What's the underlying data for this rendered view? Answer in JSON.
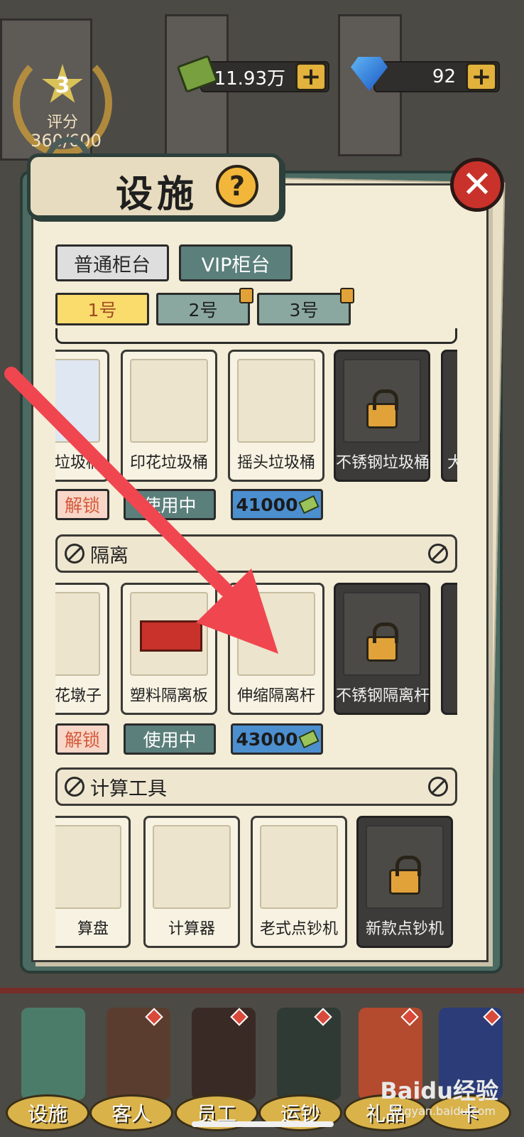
{
  "currency": {
    "cash": "11.93万",
    "gems": "92"
  },
  "rating": {
    "level": "3",
    "label": "评分",
    "score": "360/600"
  },
  "dialog": {
    "title": "设施",
    "help": "?",
    "close": "✕"
  },
  "tabs": {
    "normal": "普通柜台",
    "vip": "VIP柜台"
  },
  "counters": [
    "1号",
    "2号",
    "3号"
  ],
  "trash_row": {
    "items": [
      "垃圾桶",
      "印花垃圾桶",
      "摇头垃圾桶",
      "不锈钢垃圾桶",
      "大"
    ],
    "status": [
      "解锁",
      "使用中",
      "41000"
    ]
  },
  "isolation": {
    "section": "隔离",
    "items": [
      "花墩子",
      "塑料隔离板",
      "伸缩隔离杆",
      "不锈钢隔离杆"
    ],
    "status": [
      "解锁",
      "使用中",
      "43000"
    ]
  },
  "calc": {
    "section": "计算工具",
    "items": [
      "算盘",
      "计算器",
      "老式点钞机",
      "新款点钞机"
    ]
  },
  "nav": [
    "设施",
    "客人",
    "员工",
    "运钞",
    "礼品",
    "卡"
  ],
  "watermark": {
    "brand": "Baidu经验",
    "site": "jingyan.baidu.com"
  },
  "colors": {
    "accent_red": "#c8322a",
    "teal": "#5b7f7b",
    "gold": "#e2b23c",
    "arrow": "#f04650"
  }
}
